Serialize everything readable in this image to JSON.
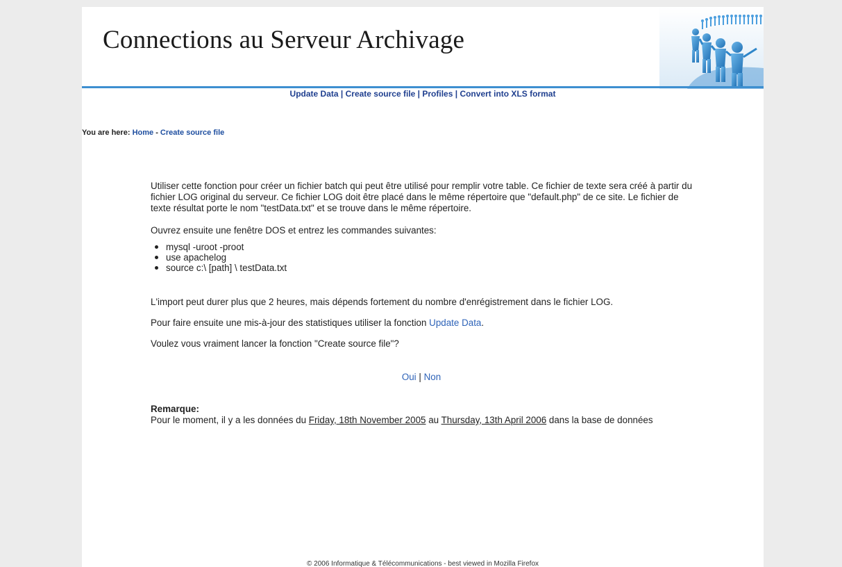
{
  "header": {
    "site_title": "Connections au Serveur Archivage"
  },
  "nav": {
    "items": [
      "Update Data",
      "Create source file",
      "Profiles",
      "Convert into XLS format"
    ],
    "separator": "|"
  },
  "breadcrumb": {
    "prefix": "You are here:",
    "home": "Home",
    "dash": "-",
    "current": "Create source file"
  },
  "content": {
    "intro": "Utiliser cette fonction pour créer un fichier batch qui peut être utilisé pour remplir votre table. Ce fichier de texte sera créé à partir du fichier LOG original du serveur. Ce fichier LOG doit être placé dans le même répertoire que \"default.php\" de ce site. Le fichier de texte résultat porte le nom \"testData.txt\" et se trouve dans le même répertoire.",
    "dos_intro": "Ouvrez ensuite une fenêtre DOS et entrez les commandes suivantes:",
    "commands": [
      "mysql -uroot -proot",
      "use apachelog",
      "source c:\\ [path] \\ testData.txt"
    ],
    "import_note": "L'import peut durer plus que 2 heures, mais dépends fortement du nombre d'enrégistrement dans le fichier LOG.",
    "update_prefix": "Pour faire ensuite une mis-à-jour des statistiques utiliser la fonction ",
    "update_link": "Update Data",
    "update_suffix": ".",
    "question": "Voulez vous vraiment lancer la fonction \"Create source file\"?",
    "yes": "Oui",
    "choice_sep": "|",
    "no": "Non",
    "remark_title": "Remarque:",
    "remark_prefix": "Pour le moment, il y a les données du ",
    "date_from": "Friday, 18th November 2005",
    "remark_mid": " au ",
    "date_to": "Thursday, 13th April 2006",
    "remark_suffix": " dans la base de données"
  },
  "footer": {
    "text": "© 2006 Informatique & Télécommunications - best viewed in Mozilla Firefox"
  },
  "colors": {
    "background": "#ececec",
    "accent_line": "#3d8fd0",
    "nav_link": "#1f3f8f",
    "body_link": "#2e63b8"
  },
  "icons": {
    "banner": "people-chain-icon"
  }
}
